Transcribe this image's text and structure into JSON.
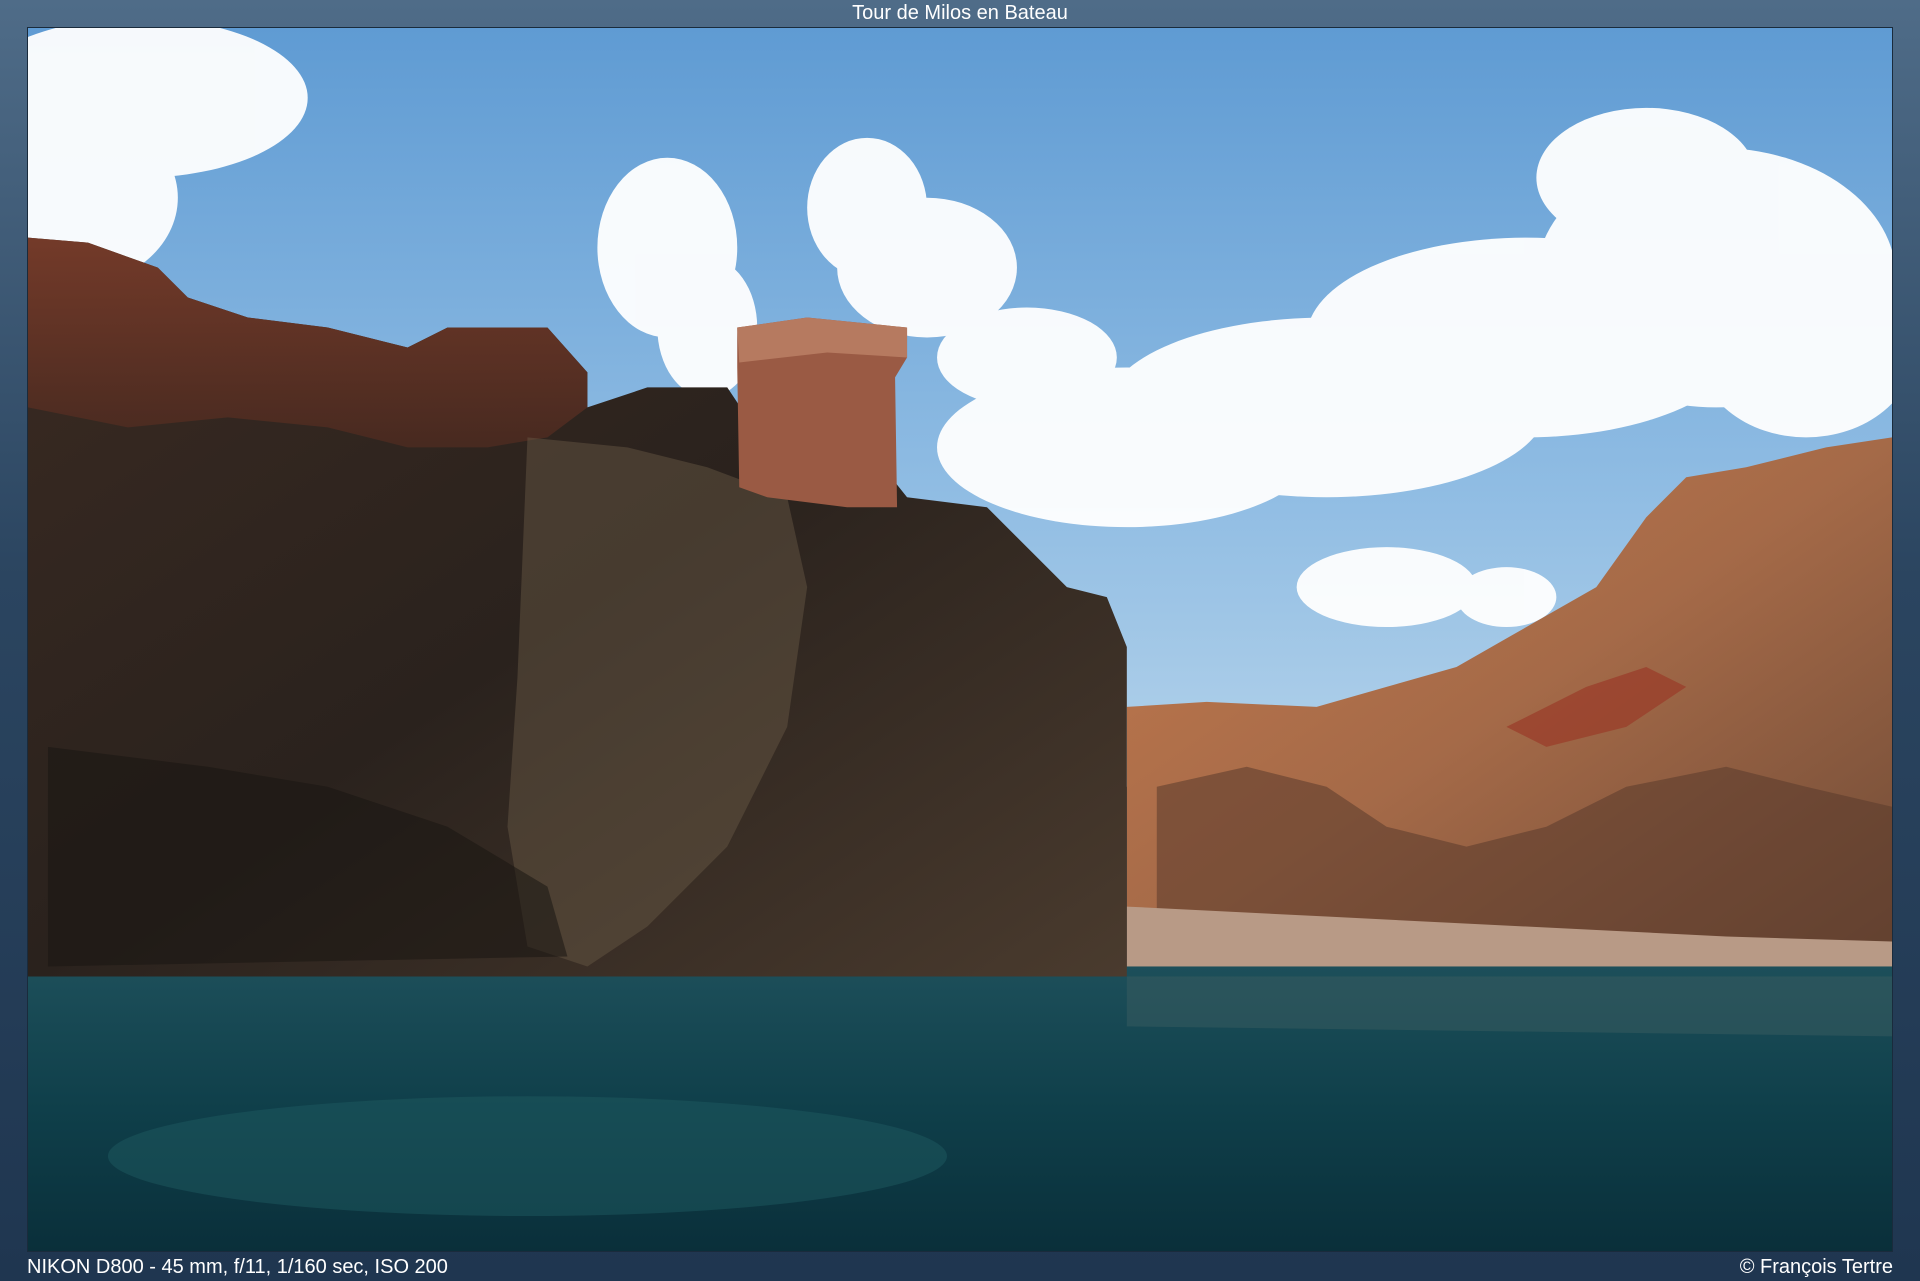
{
  "header": {
    "title": "Tour de Milos en Bateau"
  },
  "photo": {
    "subject": "coastal-cliffs-sea"
  },
  "footer": {
    "exif": "NIKON D800 - 45 mm, f/11, 1/160 sec, ISO 200",
    "copyright": "© François Tertre"
  },
  "colors": {
    "sky_top": "#6fa6d8",
    "sky_bottom": "#a9cbe8",
    "sea_deep": "#0e3b47",
    "sea_light": "#1f5e66",
    "rock_dark": "#2a211b",
    "rock_red": "#8a4a32",
    "hill_orange": "#b9805a"
  }
}
